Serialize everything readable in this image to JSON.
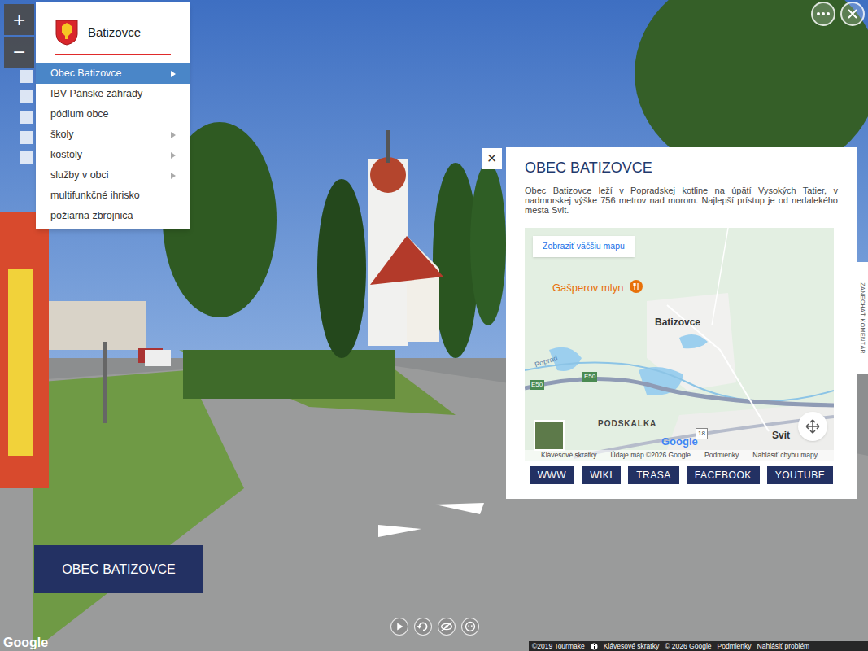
{
  "zoom": {
    "in": "+",
    "out": "−"
  },
  "menu": {
    "title": "Batizovce",
    "items": [
      {
        "label": "Obec Batizovce",
        "selected": true,
        "submenu": true
      },
      {
        "label": "IBV Pánske záhrady",
        "selected": false,
        "submenu": false
      },
      {
        "label": "pódium obce",
        "selected": false,
        "submenu": false
      },
      {
        "label": "školy",
        "selected": false,
        "submenu": true
      },
      {
        "label": "kostoly",
        "selected": false,
        "submenu": true
      },
      {
        "label": "služby v obci",
        "selected": false,
        "submenu": true
      },
      {
        "label": "multifunkčné ihrisko",
        "selected": false,
        "submenu": false
      },
      {
        "label": "požiarna zbrojnica",
        "selected": false,
        "submenu": false
      }
    ]
  },
  "info": {
    "close": "×",
    "title": "OBEC BATIZOVCE",
    "description": "Obec Batizovce leží v Popradskej kotline na úpätí Vysokých Tatier, v nadmorskej výške 756 metrov nad morom. Najlepší prístup je od nedalekého mesta Svit.",
    "map": {
      "button": "Zobraziť väčšiu mapu",
      "labels": [
        "Gašperov mlyn",
        "Batizovce",
        "Poprad",
        "E50",
        "E50",
        "PODSKALKA",
        "18",
        "Svit"
      ],
      "logo": "Google",
      "footer": [
        "Klávesové skratky",
        "Údaje máp ©2026 Google",
        "Podmienky",
        "Nahlásiť chybu mapy"
      ]
    },
    "links": [
      "WWW",
      "WIKI",
      "TRASA",
      "FACEBOOK",
      "YOUTUBE"
    ]
  },
  "scene_label": "OBEC BATIZOVCE",
  "comment_tab": "ZANECHAŤ KOMENTÁR",
  "google_logo": "Google",
  "footer": [
    "©2019 Tourmake",
    "Klávesové skratky",
    "© 2026 Google",
    "Podmienky",
    "Nahlásiť problém"
  ]
}
